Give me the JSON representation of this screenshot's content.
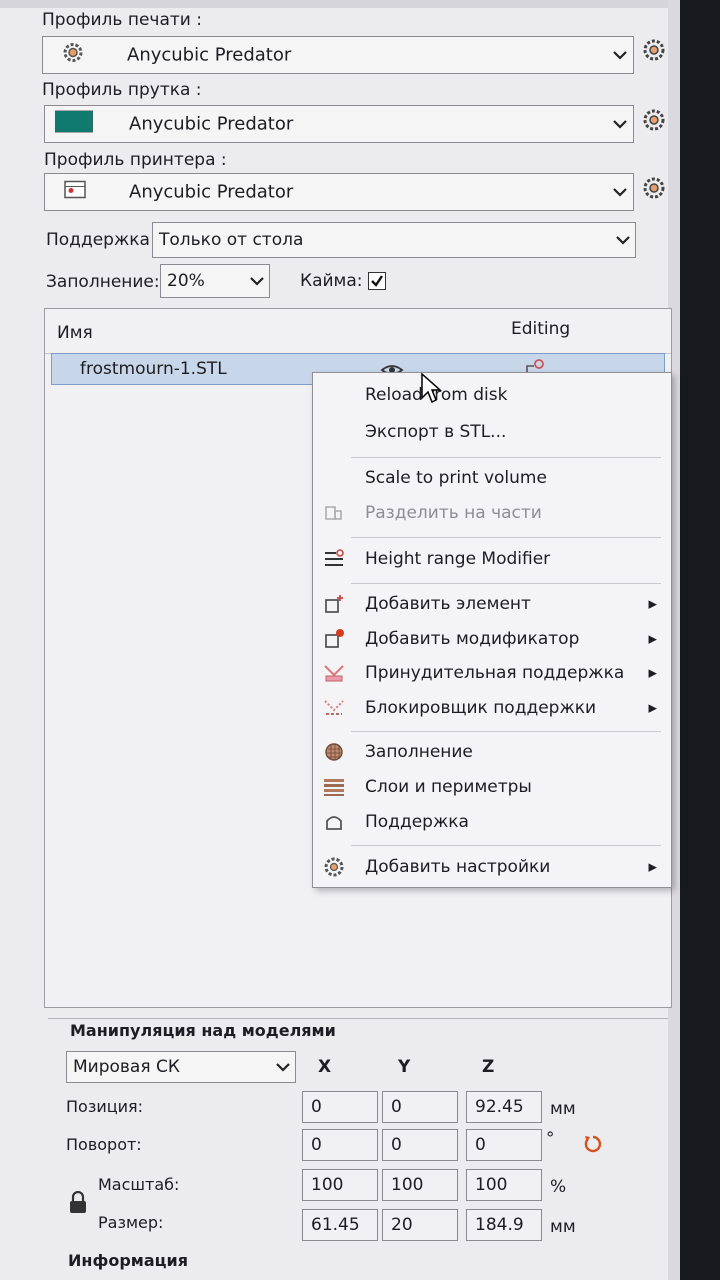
{
  "print_profile": {
    "label": "Профиль печати :",
    "value": "Anycubic Predator"
  },
  "filament_profile": {
    "label": "Профиль прутка :",
    "value": "Anycubic Predator",
    "color": "#0f7a6d"
  },
  "printer_profile": {
    "label": "Профиль принтера :",
    "value": "Anycubic Predator"
  },
  "support": {
    "label": "Поддержка:",
    "value": "Только от стола"
  },
  "infill": {
    "label": "Заполнение:",
    "value": "20%"
  },
  "brim": {
    "label": "Кайма:",
    "checked": true
  },
  "object_list": {
    "col_name": "Имя",
    "col_editing": "Editing",
    "rows": [
      {
        "name": "frostmourn-1.STL"
      }
    ]
  },
  "context_menu": {
    "items": [
      {
        "label": "Reload from disk",
        "icon": "none",
        "submenu": false,
        "disabled": false
      },
      {
        "label": "Экспорт в STL...",
        "icon": "none",
        "submenu": false,
        "disabled": false
      },
      {
        "label": "Scale to print volume",
        "icon": "none",
        "submenu": false,
        "disabled": false
      },
      {
        "label": "Разделить на части",
        "icon": "split-icon",
        "submenu": false,
        "disabled": true
      },
      {
        "label": "Height range Modifier",
        "icon": "height-range-icon",
        "submenu": false,
        "disabled": false
      },
      {
        "label": "Добавить элемент",
        "icon": "add-part-icon",
        "submenu": true,
        "disabled": false
      },
      {
        "label": "Добавить модификатор",
        "icon": "add-modifier-icon",
        "submenu": true,
        "disabled": false
      },
      {
        "label": "Принудительная поддержка",
        "icon": "support-enforcer-icon",
        "submenu": true,
        "disabled": false
      },
      {
        "label": "Блокировщик поддержки",
        "icon": "support-blocker-icon",
        "submenu": true,
        "disabled": false
      },
      {
        "label": "Заполнение",
        "icon": "infill-icon",
        "submenu": false,
        "disabled": false
      },
      {
        "label": "Слои и периметры",
        "icon": "layers-icon",
        "submenu": false,
        "disabled": false
      },
      {
        "label": "Поддержка",
        "icon": "support-icon",
        "submenu": false,
        "disabled": false
      },
      {
        "label": "Добавить настройки",
        "icon": "settings-icon",
        "submenu": true,
        "disabled": false
      }
    ]
  },
  "manipulation": {
    "title": "Манипуляция над моделями",
    "coord_system": "Мировая СК",
    "axes": [
      "X",
      "Y",
      "Z"
    ],
    "position": {
      "label": "Позиция:",
      "values": [
        "0",
        "0",
        "92.45"
      ],
      "unit": "мм"
    },
    "rotation": {
      "label": "Поворот:",
      "values": [
        "0",
        "0",
        "0"
      ],
      "unit": "°"
    },
    "scale": {
      "label": "Масштаб:",
      "values": [
        "100",
        "100",
        "100"
      ],
      "unit": "%"
    },
    "size": {
      "label": "Размер:",
      "values": [
        "61.45",
        "20",
        "184.9"
      ],
      "unit": "мм"
    }
  },
  "info": {
    "title": "Информация"
  }
}
